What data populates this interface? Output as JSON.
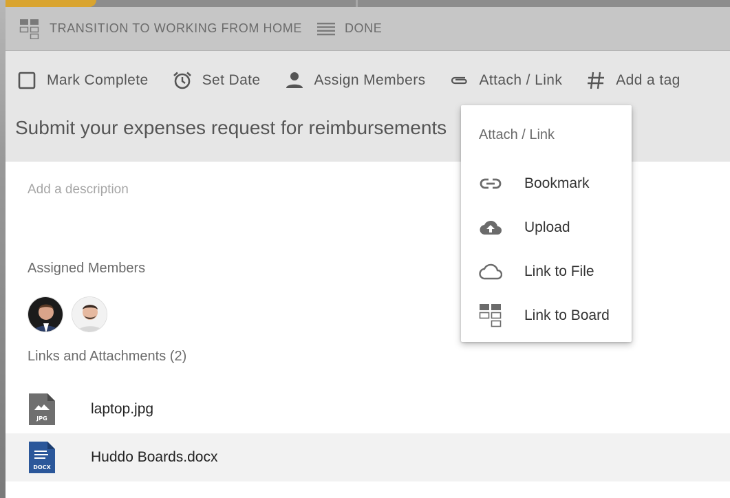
{
  "breadcrumb": {
    "board": "TRANSITION TO WORKING FROM HOME",
    "list": "DONE"
  },
  "toolbar": {
    "mark_complete": "Mark Complete",
    "set_date": "Set Date",
    "assign_members": "Assign Members",
    "attach_link": "Attach / Link",
    "add_tag": "Add a tag"
  },
  "card": {
    "title": "Submit your expenses request for reimbursements",
    "description_placeholder": "Add a description",
    "assigned_members_label": "Assigned Members",
    "links_label": "Links and Attachments (2)"
  },
  "attachments": [
    {
      "name": "laptop.jpg",
      "type_badge": "JPG",
      "icon": "image-file-icon",
      "color": "#6f6f6f"
    },
    {
      "name": "Huddo Boards.docx",
      "type_badge": "DOCX",
      "icon": "word-file-icon",
      "color": "#2b579a"
    }
  ],
  "attach_menu": {
    "title": "Attach / Link",
    "items": [
      {
        "label": "Bookmark",
        "icon": "link-icon"
      },
      {
        "label": "Upload",
        "icon": "cloud-upload-icon"
      },
      {
        "label": "Link to File",
        "icon": "cloud-icon"
      },
      {
        "label": "Link to Board",
        "icon": "board-icon"
      }
    ]
  },
  "colors": {
    "topbar": "#c6c6c6",
    "header": "#e6e6e6",
    "accent_docx": "#2b579a"
  }
}
